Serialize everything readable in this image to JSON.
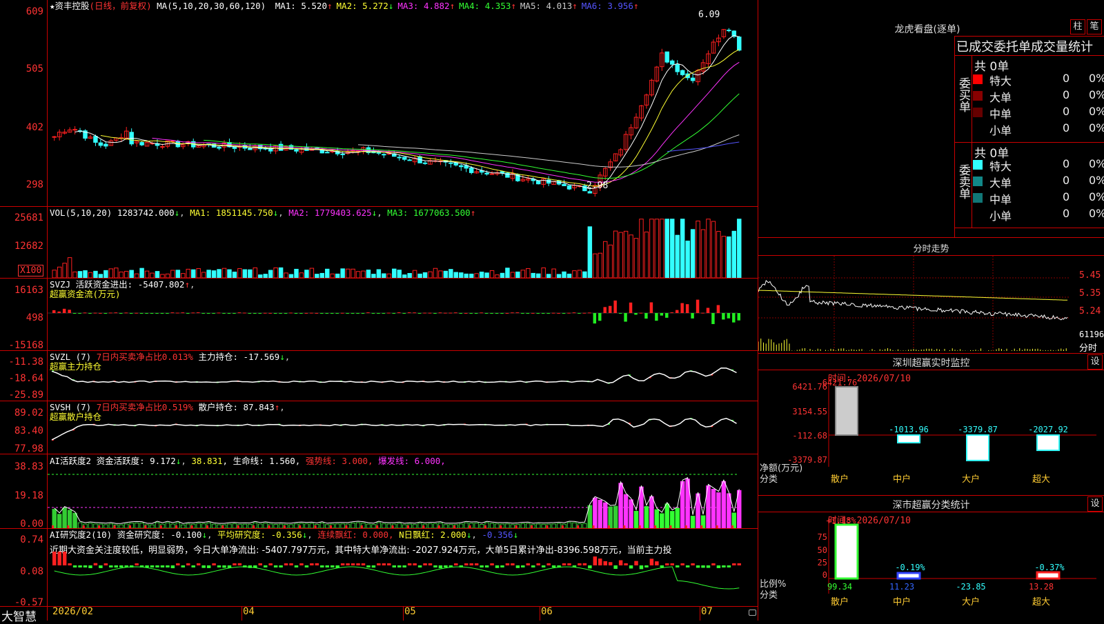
{
  "main": {
    "title_star": "★",
    "stock_name": "资丰控股",
    "mode": "(日线，前复权)",
    "ma_label": "MA(5,10,20,30,60,120)",
    "ma_values": [
      {
        "label": "MA1: 5.520",
        "arrow": "↑",
        "color": "#ffffff"
      },
      {
        "label": "MA2: 5.272",
        "arrow": "↓",
        "color": "#ffff33"
      },
      {
        "label": "MA3: 4.882",
        "arrow": "↑",
        "color": "#ff33ff"
      },
      {
        "label": "MA4: 4.353",
        "arrow": "↑",
        "color": "#33ff33"
      },
      {
        "label": "MA5: 4.013",
        "arrow": "↑",
        "color": "#cccccc"
      },
      {
        "label": "MA6: 3.956",
        "arrow": "↑",
        "color": "#5555ff"
      }
    ],
    "yticks": [
      "609",
      "505",
      "402",
      "298"
    ],
    "high_label": "6.09",
    "low_label": "2.98",
    "colors": {
      "up": "#ff2020",
      "down": "#33ffff",
      "grid": "#cc0000"
    }
  },
  "vol": {
    "title": "VOL(5,10,20)",
    "value": "1283742.000",
    "value_arrow": "↓",
    "ma1": "MA1: 1851145.750",
    "ma1_arrow": "↓",
    "ma2": "MA2: 1779403.625",
    "ma2_arrow": "↓",
    "ma3": "MA3: 1677063.500",
    "ma3_arrow": "↑",
    "yticks": [
      "25681",
      "12682"
    ],
    "unit": "X100"
  },
  "svzj": {
    "title": "SVZJ",
    "desc": "活跃资金进出: -5407.802",
    "arrow": "↑",
    "sub": "超赢资金流(万元)",
    "yticks": [
      "16163",
      "498",
      "-15168"
    ]
  },
  "svzl": {
    "title": "SVZL (7)",
    "ratio": "7日内买卖净占比0.013%",
    "desc": "主力持仓: -17.569",
    "arrow": "↓",
    "sub": "超赢主力持仓",
    "yticks": [
      "-11.38",
      "-18.64",
      "-25.89"
    ]
  },
  "svsh": {
    "title": "SVSH (7)",
    "ratio": "7日内买卖净占比0.519%",
    "desc": "散户持仓: 87.843",
    "arrow": "↑",
    "sub": "超赢散户持仓",
    "yticks": [
      "89.02",
      "83.40",
      "77.98"
    ]
  },
  "ai1": {
    "title": "AI活跃度2",
    "a": "资金活跃度: 9.172",
    "a_arrow": "↓",
    "b": "38.831",
    "b_arrow": ",",
    "c": "生命线: 1.560,",
    "d": "强势线: 3.000,",
    "e": "爆发线: 6.000,",
    "yticks": [
      "38.83",
      "19.18",
      "0.00"
    ]
  },
  "ai2": {
    "title": "AI研究度2(10)",
    "a": "资金研究度: -0.100",
    "b": "平均研究度: -0.356",
    "c": "连续飘红: 0.000,",
    "d": "N日飘红: 2.000",
    "e": "-0.356",
    "note": "近期大资金关注度较低，明显弱势，今日大单净流出: -5407.797万元，其中特大单净流出: -2027.924万元，大单5日累计净出-8396.598万元，当前主力投",
    "yticks": [
      "0.74",
      "0.08",
      "-0.57"
    ]
  },
  "xaxis": {
    "labels": [
      "2026/02",
      "04",
      "05",
      "06",
      "07"
    ],
    "brand": "大智慧"
  },
  "right": {
    "lhb_title": "龙虎看盘(逐单)",
    "btn_zhu": "柱",
    "btn_bi": "笔",
    "header": "已成交委托单成交量统计",
    "buy": {
      "side": "委买单",
      "total": "共 0单",
      "rows": [
        {
          "name": "特大",
          "count": "0",
          "pct": "0%",
          "color": "#ff0000"
        },
        {
          "name": "大单",
          "count": "0",
          "pct": "0%",
          "color": "#880000"
        },
        {
          "name": "中单",
          "count": "0",
          "pct": "0%",
          "color": "#660000"
        },
        {
          "name": "小单",
          "count": "0",
          "pct": "0%",
          "color": ""
        }
      ]
    },
    "sell": {
      "side": "委卖单",
      "total": "共 0单",
      "rows": [
        {
          "name": "特大",
          "count": "0",
          "pct": "0%",
          "color": "#33ffff"
        },
        {
          "name": "大单",
          "count": "0",
          "pct": "0%",
          "color": "#118888"
        },
        {
          "name": "中单",
          "count": "0",
          "pct": "0%",
          "color": "#117777"
        },
        {
          "name": "小单",
          "count": "0",
          "pct": "0%",
          "color": ""
        }
      ]
    },
    "intraday": {
      "title": "分时走势",
      "prices": [
        "5.45",
        "5.35",
        "5.24"
      ],
      "vol": "61196",
      "vol_label": "分时"
    },
    "monitor": {
      "title": "深圳超赢实时监控",
      "btn": "设",
      "time": "时间: 2026/07/10",
      "yticks": [
        "6421.76",
        "3154.55",
        "-112.68",
        "-3379.87"
      ],
      "ylabel": "净额(万元)",
      "xlabel": "分类",
      "cats": [
        "散户",
        "中户",
        "大户",
        "超大"
      ],
      "values": [
        "6421.76",
        "-1013.96",
        "-3379.87",
        "-2027.92"
      ]
    },
    "classify": {
      "title": "深市超赢分类统计",
      "btn": "设",
      "time": "时间: 2026/07/10",
      "yticks": [
        "75",
        "50",
        "25",
        "0"
      ],
      "ylabel": "比例%",
      "xlabel": "分类",
      "cats": [
        "散户",
        "中户",
        "大户",
        "超大"
      ],
      "top_labels": [
        "+1.18%",
        "-0.19%",
        "",
        "-0.37%"
      ],
      "bottom_values": [
        "99.34",
        "11.23",
        "-23.85",
        "13.28"
      ]
    }
  }
}
